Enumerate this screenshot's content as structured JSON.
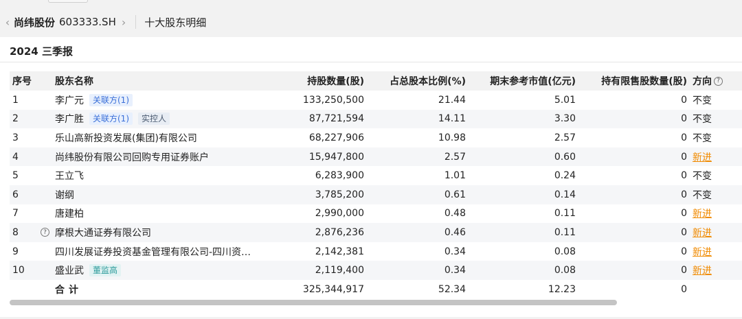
{
  "header": {
    "stock_name": "尚纬股份",
    "stock_code": "603333.SH",
    "section": "十大股东明细"
  },
  "report": {
    "title": "2024 三季报"
  },
  "table": {
    "columns": {
      "index": "序号",
      "name": "股东名称",
      "shares": "持股数量(股)",
      "pct": "占总股本比例(%)",
      "value": "期末参考市值(亿元)",
      "limited": "持有限售股数量(股)",
      "direction": "方向"
    },
    "rows": [
      {
        "index": "1",
        "name": "李广元",
        "tags": [
          "关联方(1)"
        ],
        "shares": "133,250,500",
        "pct": "21.44",
        "value": "5.01",
        "limited": "0",
        "direction": "不变"
      },
      {
        "index": "2",
        "name": "李广胜",
        "tags": [
          "关联方(1)",
          "实控人"
        ],
        "shares": "87,721,594",
        "pct": "14.11",
        "value": "3.30",
        "limited": "0",
        "direction": "不变"
      },
      {
        "index": "3",
        "name": "乐山高新投资发展(集团)有限公司",
        "tags": [],
        "shares": "68,227,906",
        "pct": "10.98",
        "value": "2.57",
        "limited": "0",
        "direction": "不变"
      },
      {
        "index": "4",
        "name": "尚纬股份有限公司回购专用证券账户",
        "tags": [],
        "shares": "15,947,800",
        "pct": "2.57",
        "value": "0.60",
        "limited": "0",
        "direction": "新进"
      },
      {
        "index": "5",
        "name": "王立飞",
        "tags": [],
        "shares": "6,283,900",
        "pct": "1.01",
        "value": "0.24",
        "limited": "0",
        "direction": "不变"
      },
      {
        "index": "6",
        "name": "谢纲",
        "tags": [],
        "shares": "3,785,200",
        "pct": "0.61",
        "value": "0.14",
        "limited": "0",
        "direction": "不变"
      },
      {
        "index": "7",
        "name": "唐建柏",
        "tags": [],
        "shares": "2,990,000",
        "pct": "0.48",
        "value": "0.11",
        "limited": "0",
        "direction": "新进"
      },
      {
        "index": "8",
        "name": "摩根大通证券有限公司",
        "tags": [],
        "shares": "2,876,236",
        "pct": "0.46",
        "value": "0.11",
        "limited": "0",
        "direction": "新进"
      },
      {
        "index": "9",
        "name": "四川发展证券投资基金管理有限公司-四川资…",
        "tags": [],
        "shares": "2,142,381",
        "pct": "0.34",
        "value": "0.08",
        "limited": "0",
        "direction": "新进"
      },
      {
        "index": "10",
        "name": "盛业武",
        "tags": [
          "董监高"
        ],
        "shares": "2,119,400",
        "pct": "0.34",
        "value": "0.08",
        "limited": "0",
        "direction": "新进"
      }
    ],
    "total": {
      "label": "合计",
      "shares": "325,344,917",
      "pct": "52.34",
      "value": "12.23",
      "limited": "0"
    }
  },
  "colors": {
    "new_direction": "#f08a00",
    "tag_blue": "#3a6fd8",
    "tag_teal": "#2a9a9a"
  }
}
